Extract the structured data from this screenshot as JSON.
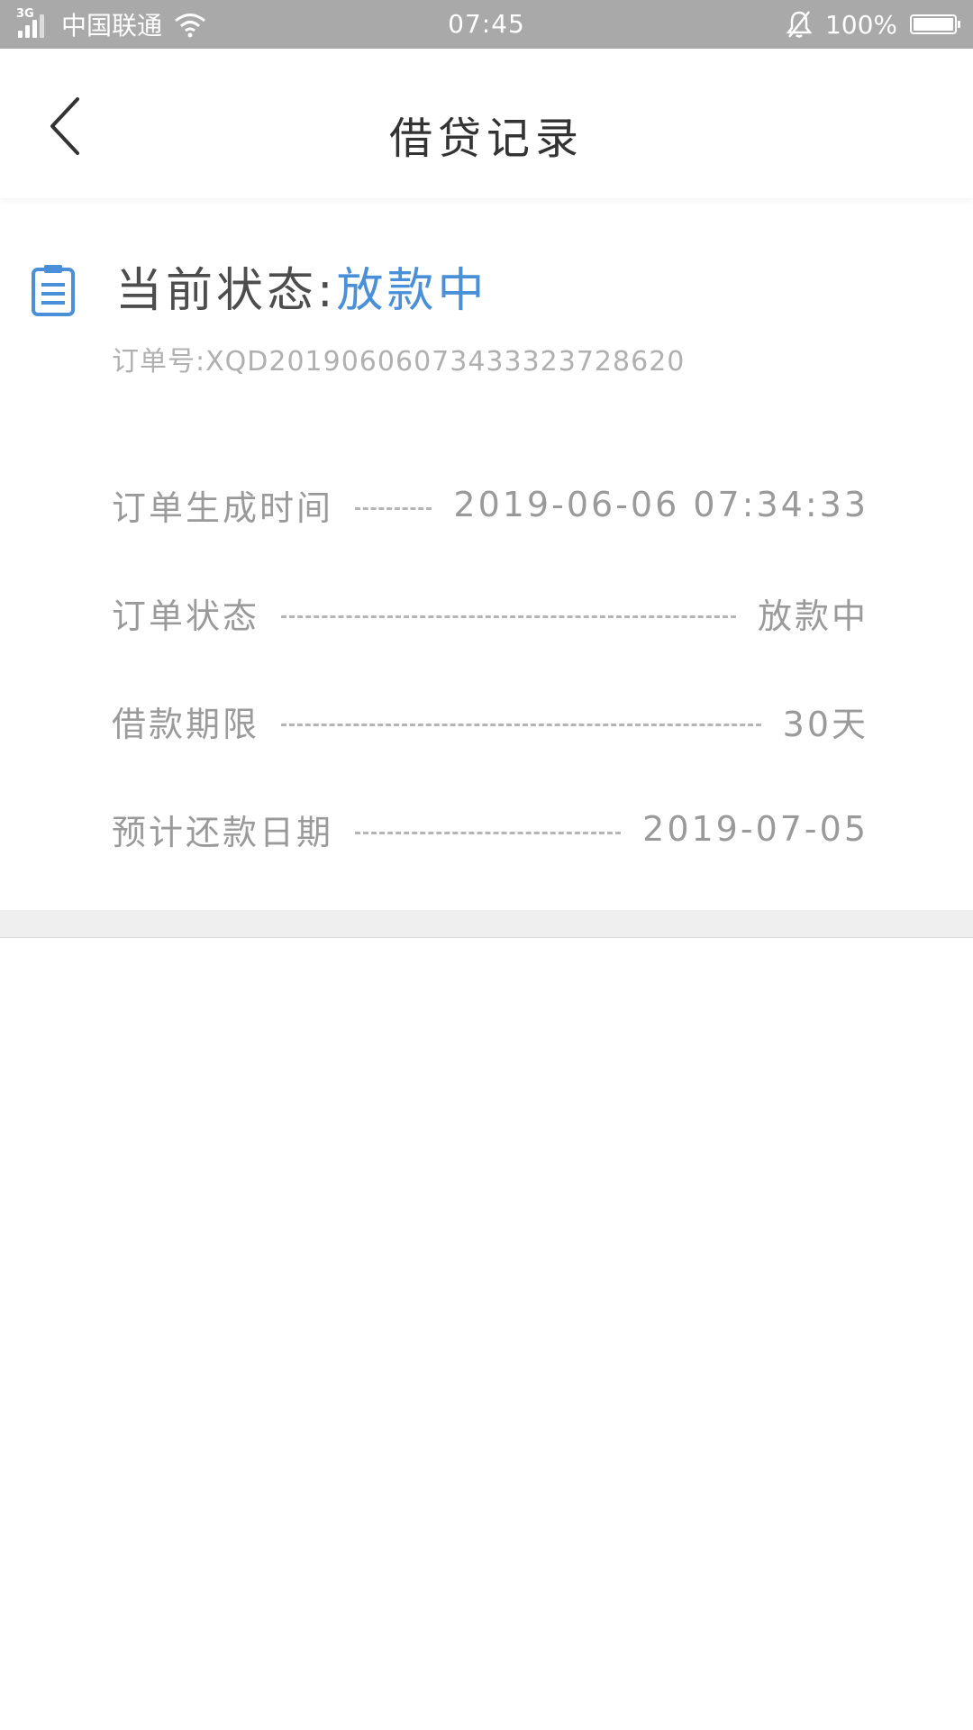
{
  "status_bar": {
    "network": "3G",
    "carrier": "中国联通",
    "time": "07:45",
    "battery_percent": "100%",
    "battery_level": 1.0
  },
  "header": {
    "title": "借贷记录",
    "back_icon": "chevron-left-icon"
  },
  "order_status": {
    "label": "当前状态:",
    "value": "放款中",
    "value_color": "#4a90d9",
    "icon": "clipboard-icon",
    "order_number": "订单号:XQD20190606073433323728620"
  },
  "details": [
    {
      "label": "订单生成时间",
      "value": "2019-06-06 07:34:33"
    },
    {
      "label": "订单状态",
      "value": "放款中"
    },
    {
      "label": "借款期限",
      "value": "30天"
    },
    {
      "label": "预计还款日期",
      "value": "2019-07-05"
    }
  ]
}
